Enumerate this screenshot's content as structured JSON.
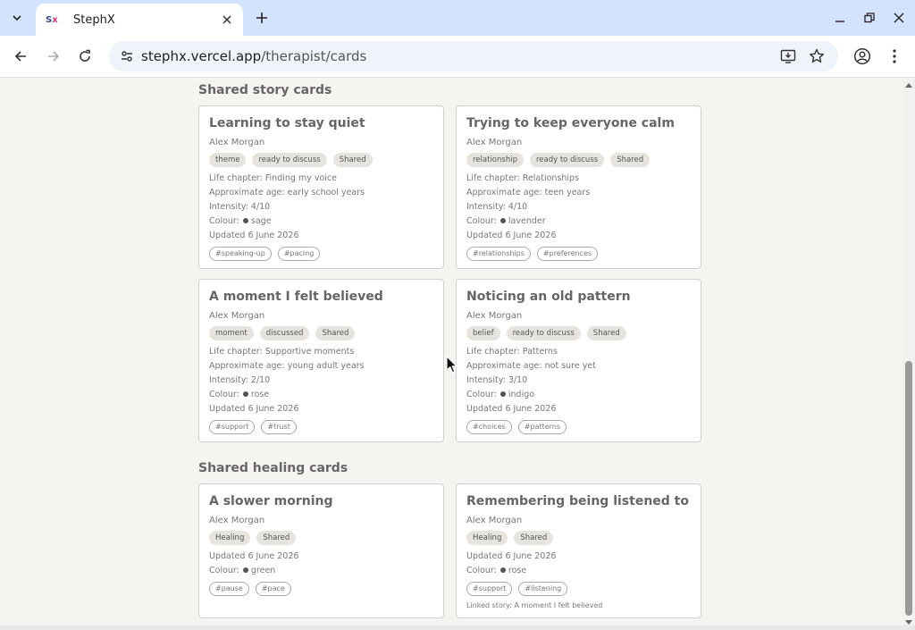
{
  "browser": {
    "tab_title": "StephX",
    "url_host": "stephx.vercel.app",
    "url_path": "/therapist/cards"
  },
  "sections": {
    "story_title": "Shared story cards",
    "healing_title": "Shared healing cards"
  },
  "story_cards": [
    {
      "title": "Learning to stay quiet",
      "author": "Alex Morgan",
      "badges": [
        "theme",
        "ready to discuss",
        "Shared"
      ],
      "chapter": "Life chapter: Finding my voice",
      "age": "Approximate age: early school years",
      "intensity": "Intensity: 4/10",
      "colour_label": "Colour:",
      "colour": "sage",
      "updated": "Updated 6 June 2026",
      "tags": [
        "#speaking-up",
        "#pacing"
      ]
    },
    {
      "title": "Trying to keep everyone calm",
      "author": "Alex Morgan",
      "badges": [
        "relationship",
        "ready to discuss",
        "Shared"
      ],
      "chapter": "Life chapter: Relationships",
      "age": "Approximate age: teen years",
      "intensity": "Intensity: 4/10",
      "colour_label": "Colour:",
      "colour": "lavender",
      "updated": "Updated 6 June 2026",
      "tags": [
        "#relationships",
        "#preferences"
      ]
    },
    {
      "title": "A moment I felt believed",
      "author": "Alex Morgan",
      "badges": [
        "moment",
        "discussed",
        "Shared"
      ],
      "chapter": "Life chapter: Supportive moments",
      "age": "Approximate age: young adult years",
      "intensity": "Intensity: 2/10",
      "colour_label": "Colour:",
      "colour": "rose",
      "updated": "Updated 6 June 2026",
      "tags": [
        "#support",
        "#trust"
      ]
    },
    {
      "title": "Noticing an old pattern",
      "author": "Alex Morgan",
      "badges": [
        "belief",
        "ready to discuss",
        "Shared"
      ],
      "chapter": "Life chapter: Patterns",
      "age": "Approximate age: not sure yet",
      "intensity": "Intensity: 3/10",
      "colour_label": "Colour:",
      "colour": "indigo",
      "updated": "Updated 6 June 2026",
      "tags": [
        "#choices",
        "#patterns"
      ]
    }
  ],
  "healing_cards": [
    {
      "title": "A slower morning",
      "author": "Alex Morgan",
      "badges": [
        "Healing",
        "Shared"
      ],
      "updated": "Updated 6 June 2026",
      "colour_label": "Colour:",
      "colour": "green",
      "tags": [
        "#pause",
        "#pace"
      ],
      "linked": ""
    },
    {
      "title": "Remembering being listened to",
      "author": "Alex Morgan",
      "badges": [
        "Healing",
        "Shared"
      ],
      "updated": "Updated 6 June 2026",
      "colour_label": "Colour:",
      "colour": "rose",
      "tags": [
        "#support",
        "#listening"
      ],
      "linked": "Linked story: A moment I felt believed"
    }
  ],
  "scroll": {
    "position_fraction": 1.0
  }
}
